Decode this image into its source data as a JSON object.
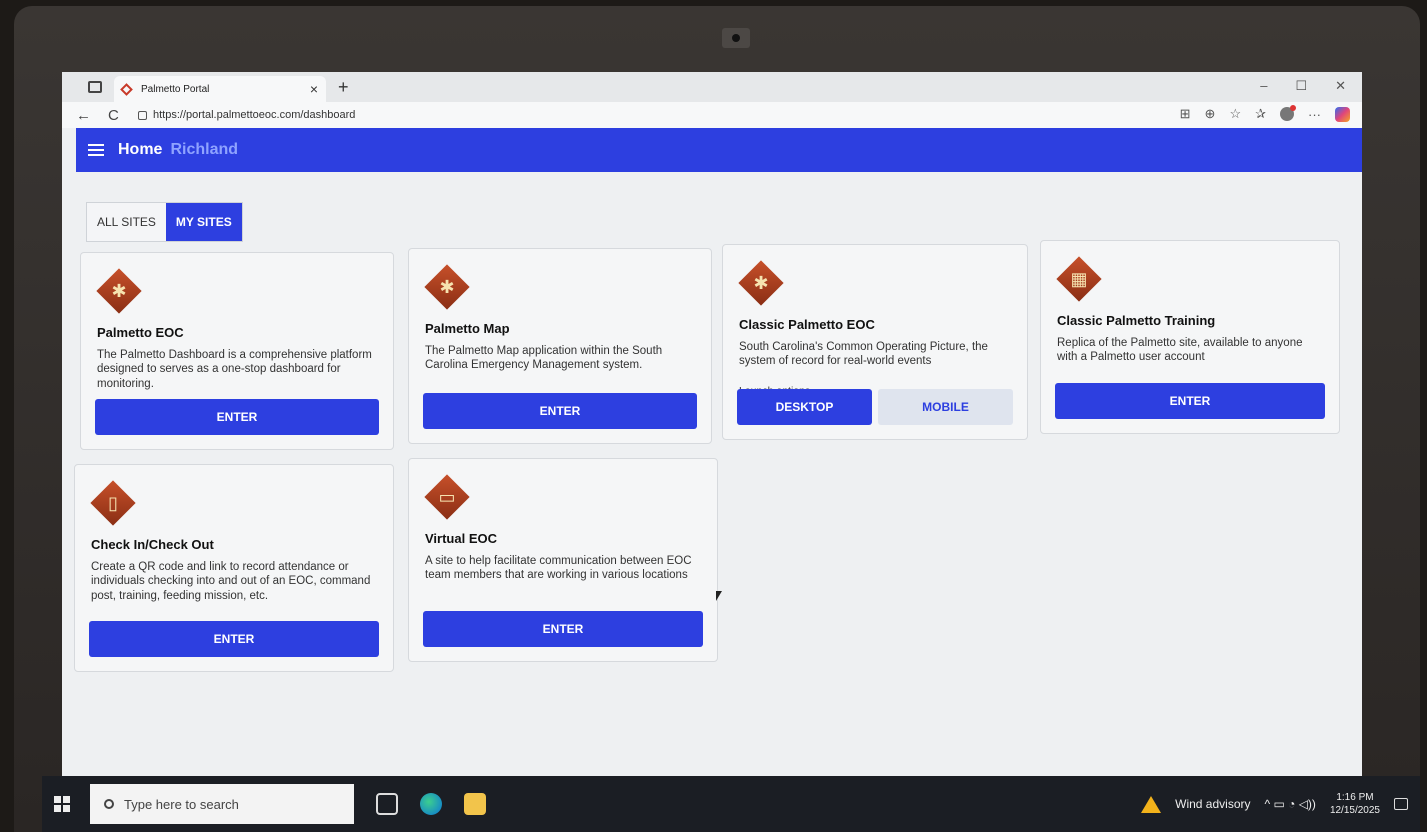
{
  "browser": {
    "tab_title": "Palmetto Portal",
    "tab_close": "×",
    "new_tab": "+",
    "url": "https://portal.palmettoeoc.com/dashboard",
    "back": "←",
    "refresh": "C",
    "window_controls": [
      "–",
      "☐",
      "✕"
    ],
    "toolbar_icons": [
      "⊞",
      "⊕",
      "☆",
      "✰",
      "···"
    ]
  },
  "appbar": {
    "home_label": "Home",
    "site_label": "Richland"
  },
  "site_tabs": [
    {
      "label": "ALL SITES",
      "active": false
    },
    {
      "label": "MY SITES",
      "active": true
    }
  ],
  "cards": [
    {
      "title": "Palmetto EOC",
      "description": "The Palmetto Dashboard is a comprehensive platform designed to serves as a one-stop dashboard for monitoring.",
      "button": "ENTER",
      "icon": "palm-tree-icon"
    },
    {
      "title": "Palmetto Map",
      "description": "The Palmetto Map application within the South Carolina Emergency Management system.",
      "button": "ENTER",
      "icon": "palm-tree-icon"
    },
    {
      "title": "Classic Palmetto EOC",
      "description": "South Carolina's Common Operating Picture, the system of record for real-world events",
      "launch_label": "Launch options",
      "buttons": [
        "DESKTOP",
        "MOBILE"
      ],
      "icon": "palm-tree-icon"
    },
    {
      "title": "Classic Palmetto Training",
      "description": "Replica of the Palmetto site, available to anyone with a Palmetto user account",
      "button": "ENTER",
      "icon": "training-board-icon"
    },
    {
      "title": "Check In/Check Out",
      "description": "Create a QR code and link to record attendance or individuals checking into and out of an EOC, command post, training, feeding mission, etc.",
      "button": "ENTER",
      "icon": "door-icon"
    },
    {
      "title": "Virtual EOC",
      "description": "A site to help facilitate communication between EOC team members that are working in various locations",
      "button": "ENTER",
      "icon": "monitor-icon"
    }
  ],
  "taskbar": {
    "search_placeholder": "Type here to search",
    "weather": "Wind advisory",
    "time": "1:16 PM",
    "date": "12/15/2025"
  },
  "colors": {
    "primary": "#2d3fe0",
    "icon_fill": "#b5431f"
  }
}
